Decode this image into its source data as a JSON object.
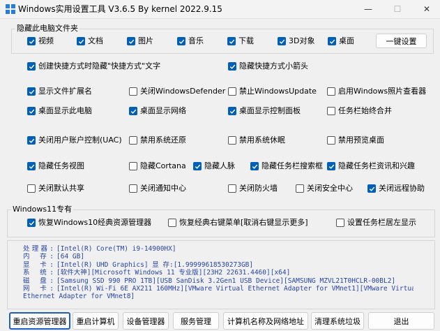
{
  "window": {
    "title": "Windows实用设置工具 V3.6.5 By kernel 2022.9.15",
    "minimize_glyph": "—",
    "maximize_glyph": "☐",
    "close_glyph": "✕"
  },
  "hide_group": {
    "label": "隐藏此电脑文件夹",
    "items": [
      {
        "label": "视频",
        "checked": true
      },
      {
        "label": "文档",
        "checked": true
      },
      {
        "label": "图片",
        "checked": true
      },
      {
        "label": "音乐",
        "checked": true
      },
      {
        "label": "下载",
        "checked": true
      },
      {
        "label": "3D对象",
        "checked": true
      },
      {
        "label": "桌面",
        "checked": true
      }
    ],
    "apply_button": "一键设置"
  },
  "options": [
    {
      "label": "创建快捷方式时隐藏\"快捷方式\"文字",
      "checked": true
    },
    {
      "label": "隐藏快捷方式小箭头",
      "checked": true
    },
    {
      "label": "显示文件扩展名",
      "checked": true
    },
    {
      "label": "关闭WindowsDefender",
      "checked": false
    },
    {
      "label": "禁止WindowsUpdate",
      "checked": false
    },
    {
      "label": "启用Windows照片查看器",
      "checked": false
    },
    {
      "label": "桌面显示此电脑",
      "checked": true
    },
    {
      "label": "桌面显示网络",
      "checked": true
    },
    {
      "label": "桌面显示控制面板",
      "checked": true
    },
    {
      "label": "任务栏始终合并",
      "checked": false
    },
    {
      "label": "关闭用户账户控制(UAC)",
      "checked": true
    },
    {
      "label": "禁用系统还原",
      "checked": false
    },
    {
      "label": "禁用系统休眠",
      "checked": false
    },
    {
      "label": "禁用预览桌面",
      "checked": false
    },
    {
      "label": "隐藏任务视图",
      "checked": true
    },
    {
      "label": "隐藏Cortana",
      "checked": false
    },
    {
      "label": "隐藏人脉",
      "checked": true
    },
    {
      "label": "隐藏任务栏搜索框",
      "checked": true
    },
    {
      "label": "隐藏任务栏资讯和兴趣",
      "checked": true
    },
    {
      "label": "关闭默认共享",
      "checked": false
    },
    {
      "label": "关闭通知中心",
      "checked": false
    },
    {
      "label": "关闭防火墙",
      "checked": false
    },
    {
      "label": "关闭安全中心",
      "checked": false
    },
    {
      "label": "关闭远程协助",
      "checked": true
    }
  ],
  "win11_group": {
    "label": "Windows11专有",
    "items": [
      {
        "label": "恢复Windows10经典资源管理器",
        "checked": true
      },
      {
        "label": "恢复经典右键菜单[取消右键显示更多]",
        "checked": false
      },
      {
        "label": "设置任务栏居左显示",
        "checked": false
      }
    ]
  },
  "system_info": [
    {
      "label": "处理器:",
      "value": "[Intel(R) Core(TM) i9-14900HX]"
    },
    {
      "label": "内 存:",
      "value": "[64 GB]"
    },
    {
      "label": "显 卡:",
      "value": "[Intel(R) UHD Graphics]  显 存:[1.99999618530273GB]"
    },
    {
      "label": "系 统:",
      "value": "[软件大神][Microsoft Windows 11 专业版][23H2 22631.4460][x64]"
    },
    {
      "label": "磁 盘:",
      "value": "[Samsung SSD 990 PRO 1TB][USB  SanDisk 3.2Gen1 USB Device][SAMSUNG MZVL21T0HCLR-00BL2]"
    },
    {
      "label": "网 卡:",
      "value": "[Intel(R) Wi-Fi 6E AX211 160MHz][VMware Virtual Ethernet Adapter for VMnet1][VMware Virtual"
    },
    {
      "label": "",
      "value": "Ethernet Adapter for VMnet8]"
    }
  ],
  "bottom_buttons": [
    "重启资源管理器",
    "重启计算机",
    "设备管理器",
    "服务管理",
    "计算机名称及网络地址",
    "清理系统垃圾",
    "退出"
  ],
  "colors": {
    "accent": "#005fb8",
    "info_text": "#2645a8"
  }
}
